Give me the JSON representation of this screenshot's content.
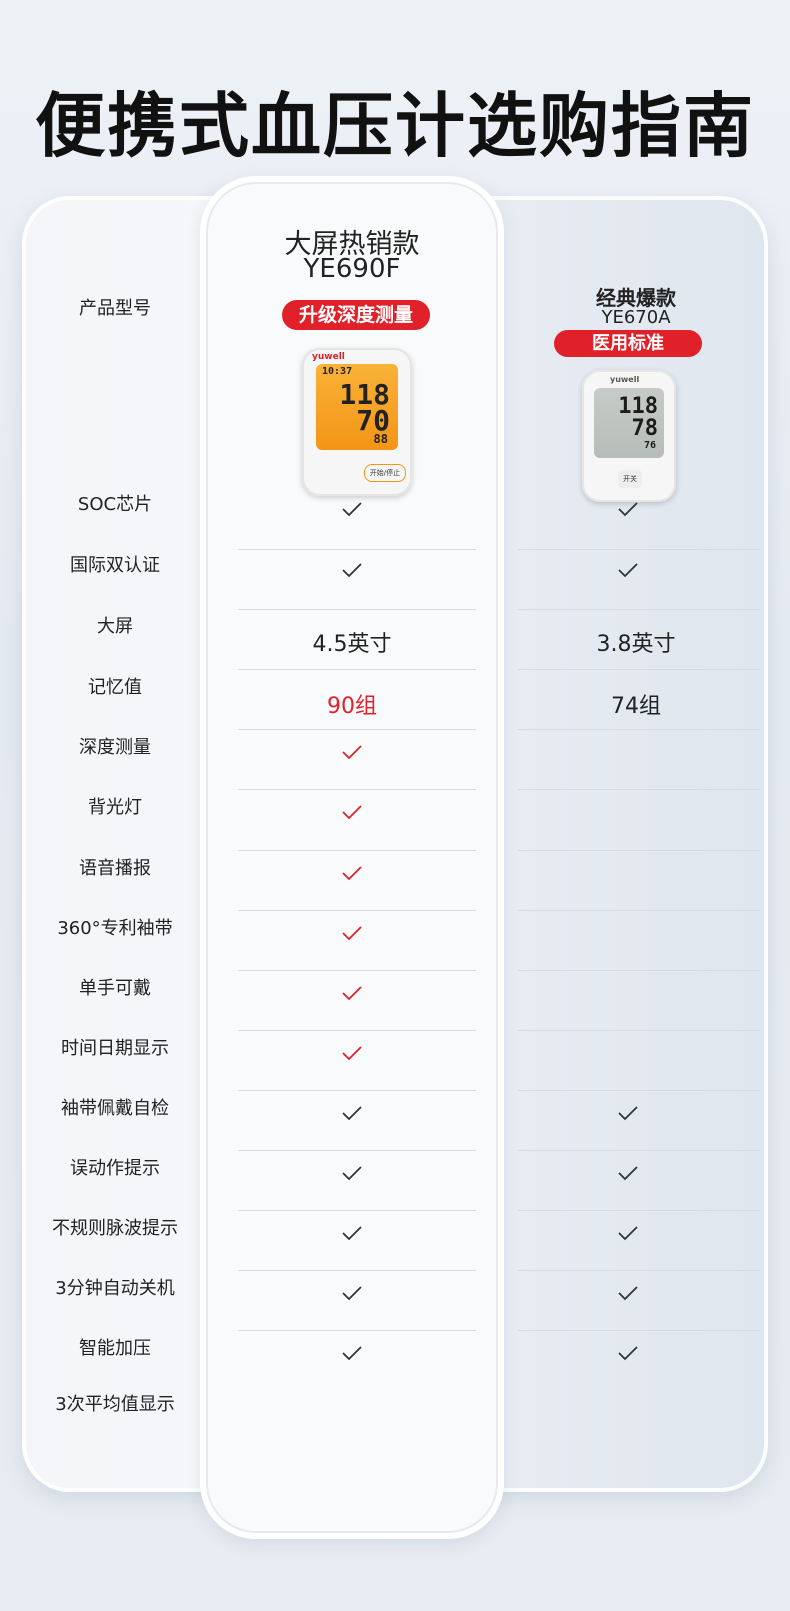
{
  "title": "便携式血压计选购指南",
  "row_labels": [
    "产品型号",
    "SOC芯片",
    "国际双认证",
    "大屏",
    "记忆值",
    "深度测量",
    "背光灯",
    "语音播报",
    "360°专利袖带",
    "单手可戴",
    "时间日期显示",
    "袖带佩戴自检",
    "误动作提示",
    "不规则脉波提示",
    "3分钟自动关机",
    "智能加压",
    "3次平均值显示"
  ],
  "col_a": {
    "name": "大屏热销款",
    "model": "YE690F",
    "badge": "升级深度测量",
    "device": {
      "brand": "yuwell",
      "time": "10:37",
      "sys": "118",
      "dia": "70",
      "pulse": "88",
      "button": "开始/停止"
    },
    "screen_size": "4.5英寸",
    "memory": "90组"
  },
  "col_b": {
    "name": "经典爆款",
    "model": "YE670A",
    "badge": "医用标准",
    "device": {
      "brand": "yuwell",
      "sys": "118",
      "dia": "78",
      "pulse": "76",
      "button": "开关"
    },
    "screen_size": "3.8英寸",
    "memory": "74组"
  },
  "checks": {
    "a": [
      "black",
      "black",
      null,
      null,
      "red",
      "red",
      "red",
      "red",
      "red",
      "red",
      "black",
      "black",
      "black",
      "black",
      "black",
      null
    ],
    "b": [
      "black",
      "black",
      null,
      null,
      null,
      null,
      null,
      null,
      null,
      null,
      "black",
      "black",
      "black",
      "black",
      "black",
      null
    ]
  },
  "colors": {
    "red": "#e0212a",
    "black": "#333333",
    "accent_orange": "#f7a21b"
  }
}
